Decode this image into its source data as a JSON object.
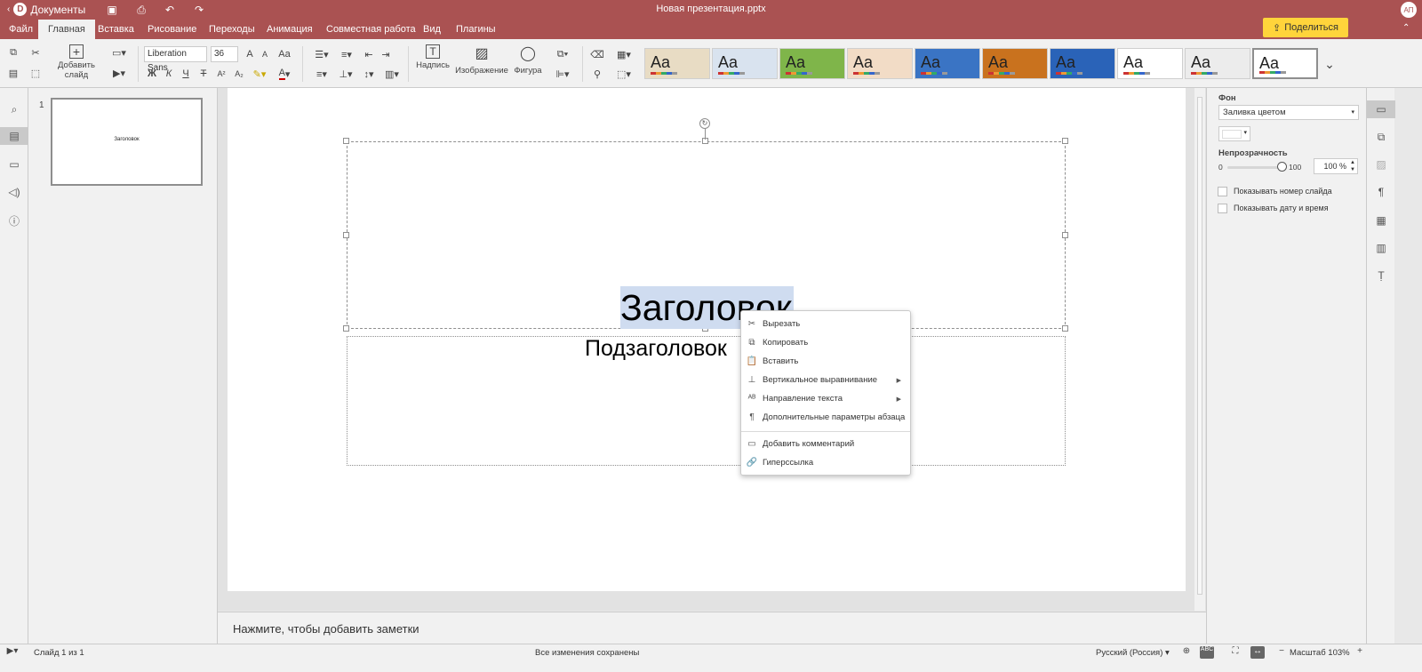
{
  "app": {
    "name": "Документы",
    "document_title": "Новая презентация.pptx",
    "user_initials": "АП"
  },
  "tabs": [
    {
      "label": "Файл",
      "active": false
    },
    {
      "label": "Главная",
      "active": true
    },
    {
      "label": "Вставка",
      "active": false
    },
    {
      "label": "Рисование",
      "active": false
    },
    {
      "label": "Переходы",
      "active": false
    },
    {
      "label": "Анимация",
      "active": false
    },
    {
      "label": "Совместная работа",
      "active": false
    },
    {
      "label": "Вид",
      "active": false
    },
    {
      "label": "Плагины",
      "active": false
    }
  ],
  "share_label": "Поделиться",
  "toolbar": {
    "add_slide": "Добавить слайд",
    "font_name": "Liberation Sans",
    "font_size": "36",
    "bold": "Ж",
    "italic": "К",
    "underline": "Ч",
    "strike": "Т",
    "superscript": "A²",
    "subscript": "A₂",
    "increase_font": "A",
    "decrease_font": "A",
    "change_case": "Aa",
    "text_box": "Надпись",
    "image": "Изображение",
    "shape": "Фигура"
  },
  "themes": [
    {
      "label": "Aa",
      "bg": "#e8dcc4"
    },
    {
      "label": "Aa",
      "bg": "#d9e3ef"
    },
    {
      "label": "Aa",
      "bg": "#7fb54a"
    },
    {
      "label": "Aa",
      "bg": "#f2dcc6"
    },
    {
      "label": "Aa",
      "bg": "#3a74c4"
    },
    {
      "label": "Aa",
      "bg": "#c9721e"
    },
    {
      "label": "Aa",
      "bg": "#2a63b8"
    },
    {
      "label": "Aa",
      "bg": "#ffffff"
    },
    {
      "label": "Aa",
      "bg": "#ececec"
    },
    {
      "label": "Aa",
      "bg": "#ffffff"
    }
  ],
  "slides": [
    {
      "number": "1",
      "title": "Заголовок"
    }
  ],
  "slide": {
    "title": "Заголовок",
    "subtitle": "Подзаголовок"
  },
  "context_menu": [
    {
      "label": "Вырезать",
      "icon": "cut-icon",
      "glyph": "✂",
      "submenu": false
    },
    {
      "label": "Копировать",
      "icon": "copy-icon",
      "glyph": "⧉",
      "submenu": false
    },
    {
      "label": "Вставить",
      "icon": "paste-icon",
      "glyph": "📋",
      "submenu": false
    },
    {
      "label": "Вертикальное выравнивание",
      "icon": "vertical-align-icon",
      "glyph": "⊥",
      "submenu": true
    },
    {
      "label": "Направление текста",
      "icon": "text-direction-icon",
      "glyph": "ᴬᴮ",
      "submenu": true
    },
    {
      "label": "Дополнительные параметры абзаца",
      "icon": "paragraph-icon",
      "glyph": "¶",
      "submenu": false
    },
    {
      "label": "Добавить комментарий",
      "icon": "comment-icon",
      "glyph": "▭",
      "submenu": false
    },
    {
      "label": "Гиперссылка",
      "icon": "link-icon",
      "glyph": "🔗",
      "submenu": false
    }
  ],
  "notes_placeholder": "Нажмите, чтобы добавить заметки",
  "right_panel": {
    "background_label": "Фон",
    "fill_type": "Заливка цветом",
    "opacity_label": "Непрозрачность",
    "opacity_min": "0",
    "opacity_max": "100",
    "opacity_value": "100 %",
    "opacity_level": 1.0,
    "show_slide_number": "Показывать номер слайда",
    "show_date_time": "Показывать дату и время"
  },
  "status": {
    "slide_info": "Слайд 1 из 1",
    "save_status": "Все изменения сохранены",
    "language": "Русский (Россия)",
    "zoom": "Масштаб 103%"
  }
}
